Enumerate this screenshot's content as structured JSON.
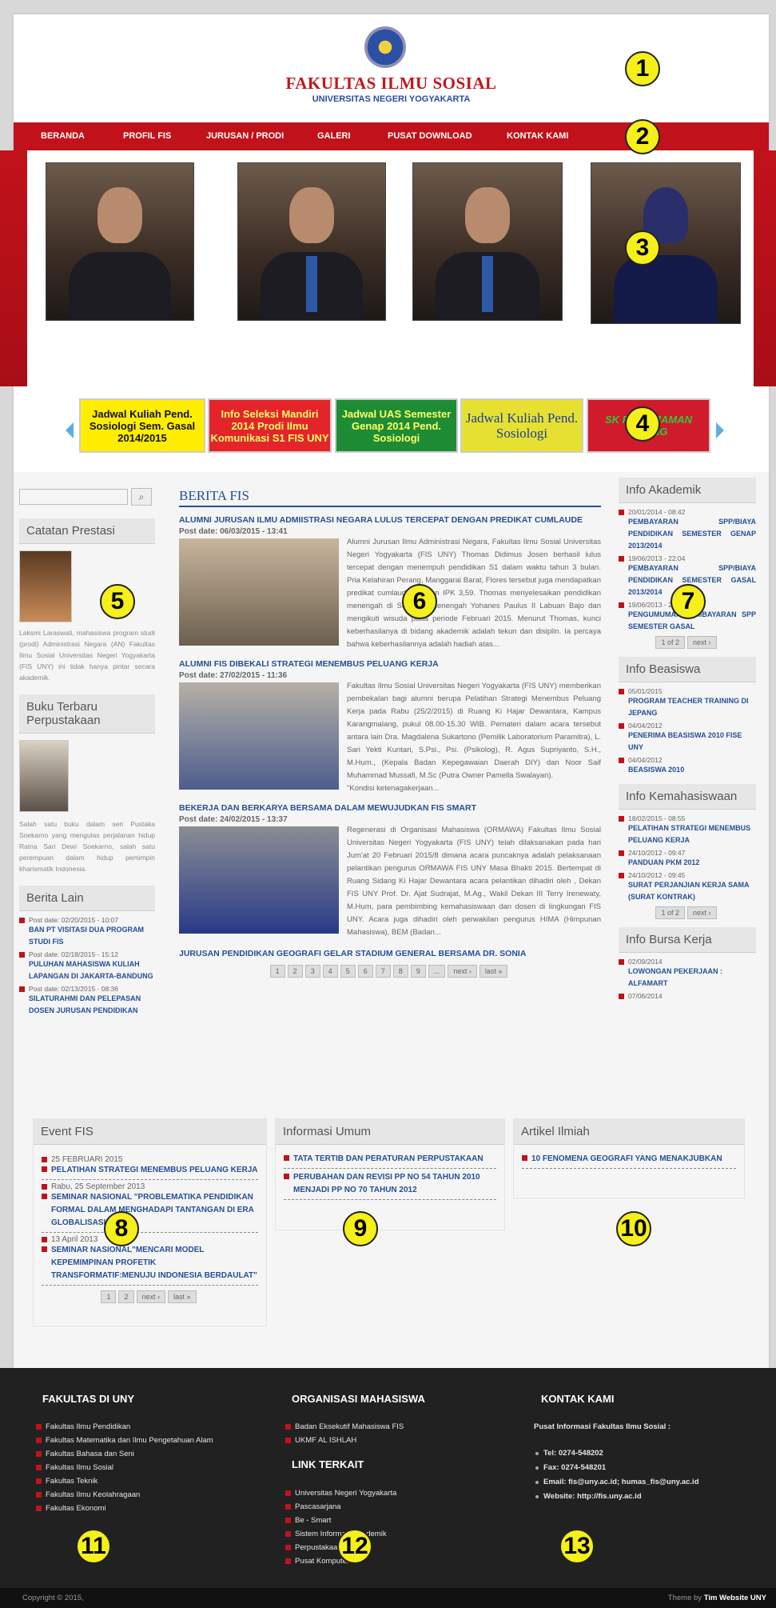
{
  "header": {
    "title": "FAKULTAS ILMU SOSIAL",
    "subtitle": "UNIVERSITAS NEGERI YOGYAKARTA"
  },
  "nav": [
    "BERANDA",
    "PROFIL FIS",
    "JURUSAN / PRODI",
    "GALERI",
    "PUSAT DOWNLOAD",
    "KONTAK KAMI"
  ],
  "banners": [
    {
      "text": "Jadwal Kuliah Pend. Sosiologi Sem. Gasal 2014/2015",
      "bg": "#ffed00",
      "fg": "#111111"
    },
    {
      "text": "Info Seleksi Mandiri 2014 Prodi Ilmu Komunikasi S1 FIS UNY",
      "bg": "#e4242b",
      "fg": "#ffff66"
    },
    {
      "text": "Jadwal UAS Semester Genap 2014 Pend. Sosiologi",
      "bg": "#1e8c35",
      "fg": "#ffff66"
    },
    {
      "text": "Jadwal Kuliah Pend. Sosiologi",
      "bg": "#e6e032",
      "fg": "#1e3f92"
    },
    {
      "text": "SK PEMINJAMAN RUANG",
      "bg": "#cf1b2b",
      "fg": "#2ecc3a"
    }
  ],
  "left": {
    "search_icon": "search-icon",
    "catatan_title": "Catatan Prestasi",
    "catatan_text": "Laksmi Laraswati, mahasiswa program studi (prodi) Administrasi Negara (AN) Fakultas Ilmu Sosial Universitas Negeri Yogyakarta (FIS UNY) ini tidak hanya pintar secara akademik.",
    "buku_title": "Buku Terbaru Perpustakaan",
    "buku_text": "Salah satu buku dalam seri Pustaka Soekarno yang mengulas perjalanan hidup Ratna Sari Dewi Soekarno, salah satu perempuan dalam hidup pemimpin kharismatik Indonesia.",
    "lain_title": "Berita Lain",
    "lain_items": [
      {
        "date": "Post date: 02/20/2015 - 10:07",
        "title": "BAN PT VISITASI DUA PROGRAM STUDI FIS"
      },
      {
        "date": "Post date: 02/18/2015 - 15:12",
        "title": "PULUHAN MAHASISWA KULIAH LAPANGAN DI JAKARTA-BANDUNG"
      },
      {
        "date": "Post date: 02/13/2015 - 08:36",
        "title": "SILATURAHMI DAN PELEPASAN DOSEN JURUSAN PENDIDIKAN"
      }
    ]
  },
  "main": {
    "heading": "BERITA FIS",
    "articles": [
      {
        "title": "ALUMNI JURUSAN ILMU ADMIISTRASI NEGARA LULUS TERCEPAT DENGAN PREDIKAT CUMLAUDE",
        "date": "Post date: 06/03/2015 - 13:41",
        "body": "Alumni Jurusan Ilmu Administrasi Negara, Fakultas Ilmu Sosial Universitas Negeri Yogyakarta (FIS UNY) Thomas Didimus Josen berhasil lulus tercepat dengan menempuh pendidikan S1 dalam waktu tahun 3 bulan. Pria Kelahiran Perang, Manggarai Barat, Flores tersebut juga mendapatkan predikat cumlaude dengan IPK 3,59. Thomas menyelesaikan pendidikan menengah di Seminari Menengah Yohanes Paulus II Labuan Bajo dan mengikuti wisuda pada periode Februari 2015. Menurut Thomas, kunci keberhasilanya di bidang akademik adalah tekun dan disiplin. Ia percaya bahwa keberhasilannya adalah hadiah atas..."
      },
      {
        "title": "ALUMNI FIS DIBEKALI STRATEGI MENEMBUS PELUANG KERJA",
        "date": "Post date: 27/02/2015 - 11:36",
        "body": "Fakultas Ilmu Sosial Universitas Negeri Yogyakarta (FIS UNY) memberikan pembekalan bagi alumni berupa Pelatihan Strategi Menembus Peluang Kerja pada Rabu (25/2/2015) di Ruang Ki Hajar Dewantara, Kampus Karangmalang, pukul 08.00-15.30 WIB. Pemateri dalam acara tersebut antara lain Dra. Magdalena Sukartono (Pemilik Laboratorium Paramitra), L. Sari Yekti Kuntari, S.Psi., Psi. (Psikolog), R. Agus Supriyanto, S.H., M.Hum., (Kepala Badan Kepegawaian Daerah DIY) dan Noor Saif Muhammad Mussafi, M.Sc (Putra Owner Pamella Swalayan).",
        "extra": "\"Kondisi ketenagakerjaan..."
      },
      {
        "title": "BEKERJA DAN BERKARYA BERSAMA DALAM MEWUJUDKAN FIS SMART",
        "date": "Post date: 24/02/2015 - 13:37",
        "body": "Regenerasi di Organisasi Mahasiswa (ORMAWA) Fakultas Ilmu Sosial Universitas Negeri Yogyakarta (FIS UNY) telah dilaksanakan pada hari Jum'at 20 Februari 2015/8 dimana acara puncaknya adalah pelaksanaan pelantikan pengurus ORMAWA FIS UNY Masa Bhakti 2015. Bertempat di Ruang Sidang Ki Hajar Dewantara acara pelantikan dihadiri oleh , Dekan FIS UNY Prof. Dr. Ajat Sudrajat, M.Ag., Wakil Dekan III Terry Irenewaty, M.Hum, para pembimbing kemahasiswaan dan dosen di lingkungan FIS UNY. Acara juga dihadiri oleh perwakilan pengurus HIMA (Himpunan Mahasiswa), BEM (Badan..."
      },
      {
        "title": "JURUSAN PENDIDIKAN GEOGRAFI GELAR STADIUM GENERAL BERSAMA DR. SONIA"
      }
    ],
    "pager": [
      "1",
      "2",
      "3",
      "4",
      "5",
      "6",
      "7",
      "8",
      "9",
      "...",
      "next ›",
      "last »"
    ]
  },
  "right": {
    "akademik_title": "Info Akademik",
    "akademik_items": [
      {
        "date": "20/01/2014 - 08:42",
        "title": "PEMBAYARAN SPP/BIAYA PENDIDIKAN SEMESTER GENAP 2013/2014"
      },
      {
        "date": "19/06/2013 - 22:04",
        "title": "PEMBAYARAN SPP/BIAYA PENDIDIKAN SEMESTER GASAL 2013/2014"
      },
      {
        "date": "19/06/2013 - 21:58",
        "title": "PENGUMUMAN PEMBAYARAN SPP SEMESTER GASAL"
      }
    ],
    "akademik_pager": [
      "1 of 2",
      "next ›"
    ],
    "beasiswa_title": "Info Beasiswa",
    "beasiswa_items": [
      {
        "date": "05/01/2015",
        "title": "PROGRAM TEACHER TRAINING DI JEPANG"
      },
      {
        "date": "04/04/2012",
        "title": "PENERIMA BEASISWA 2010 FISE UNY"
      },
      {
        "date": "04/04/2012",
        "title": "BEASISWA 2010"
      }
    ],
    "kemahasiswaan_title": "Info Kemahasiswaan",
    "kemahasiswaan_items": [
      {
        "date": "18/02/2015 - 08:55",
        "title": "PELATIHAN STRATEGI MENEMBUS PELUANG KERJA"
      },
      {
        "date": "24/10/2012 - 09:47",
        "title": "PANDUAN PKM 2012"
      },
      {
        "date": "24/10/2012 - 09:45",
        "title": "SURAT PERJANJIAN KERJA SAMA (SURAT KONTRAK)"
      }
    ],
    "kemahasiswaan_pager": [
      "1 of 2",
      "next ›"
    ],
    "bursa_title": "Info Bursa Kerja",
    "bursa_items": [
      {
        "date": "02/09/2014",
        "title": "LOWONGAN PEKERJAAN : ALFAMART"
      },
      {
        "date": "07/06/2014",
        "title": ""
      }
    ]
  },
  "event": {
    "title": "Event FIS",
    "items": [
      {
        "date": "25 FEBRUARI 2015",
        "title": "PELATIHAN STRATEGI MENEMBUS PELUANG KERJA"
      },
      {
        "date": "Rabu, 25 September 2013",
        "title": "SEMINAR NASIONAL \"PROBLEMATIKA PENDIDIKAN FORMAL DALAM MENGHADAPI TANTANGAN DI ERA GLOBALISASI\""
      },
      {
        "date": "13 April 2013",
        "title": "SEMINAR NASIONAL\"MENCARI MODEL KEPEMIMPINAN PROFETIK TRANSFORMATIF:MENUJU INDONESIA BERDAULAT\""
      }
    ],
    "pager": [
      "1",
      "2",
      "next ›",
      "last »"
    ]
  },
  "umum": {
    "title": "Informasi Umum",
    "items": [
      "TATA TERTIB DAN PERATURAN PERPUSTAKAAN",
      "PERUBAHAN DAN REVISI PP NO 54 TAHUN 2010 MENJADI PP NO 70 TAHUN 2012"
    ]
  },
  "artikel": {
    "title": "Artikel Ilmiah",
    "items": [
      "10 FENOMENA GEOGRAFI YANG MENAKJUBKAN"
    ]
  },
  "footer": {
    "fakultas_title": "FAKULTAS DI UNY",
    "fakultas": [
      "Fakultas Ilmu Pendidikan",
      "Fakultas Matematika dan Ilmu Pengetahuan Alam",
      "Fakultas Bahasa dan Seni",
      "Fakultas Ilmu Sosial",
      "Fakultas Teknik",
      "Fakultas Ilmu Keolahragaan",
      "Fakultas Ekonomi"
    ],
    "ormawa_title": "ORGANISASI MAHASISWA",
    "ormawa": [
      "Badan Eksekutif Mahasiswa FIS",
      "UKMF AL ISHLAH"
    ],
    "link_title": "LINK TERKAIT",
    "links": [
      "Universitas Negeri Yogyakarta",
      "Pascasarjana",
      "Be - Smart",
      "Sistem Informasi Akademik",
      "Perpustakaan",
      "Pusat Komputer"
    ],
    "kontak_title": "KONTAK KAMI",
    "kontak_head": "Pusat Informasi Fakultas Ilmu Sosial :",
    "kontak": [
      "Tel: 0274-548202",
      "Fax: 0274-548201",
      "Email: fis@uny.ac.id; humas_fis@uny.ac.id",
      "Website: http://fis.uny.ac.id"
    ],
    "copyright": "Copyright © 2015,",
    "theme_by": "Theme by ",
    "theme_name": "Tim Website UNY"
  },
  "markers": [
    "1",
    "2",
    "3",
    "4",
    "5",
    "6",
    "7",
    "8",
    "9",
    "10",
    "11",
    "12",
    "13"
  ]
}
